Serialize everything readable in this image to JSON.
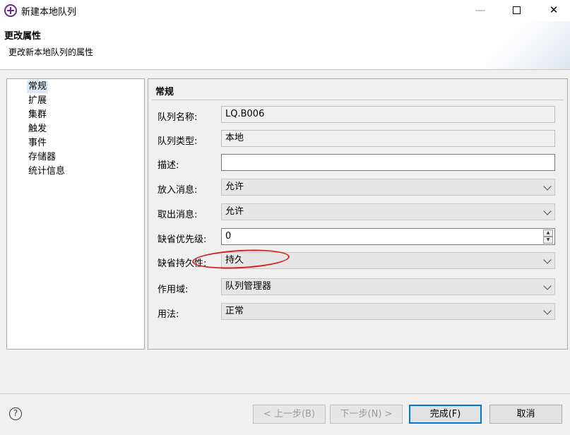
{
  "window": {
    "title": "新建本地队列",
    "minimize_icon": "—",
    "close_icon": "✕"
  },
  "banner": {
    "title": "更改属性",
    "subtitle": "更改新本地队列的属性"
  },
  "nav": {
    "items": [
      "常规",
      "扩展",
      "集群",
      "触发",
      "事件",
      "存储器",
      "统计信息"
    ],
    "selected": "常规"
  },
  "panel": {
    "title": "常规",
    "fields": {
      "queue_name": {
        "label": "队列名称:",
        "value": "LQ.B006"
      },
      "queue_type": {
        "label": "队列类型:",
        "value": "本地"
      },
      "description": {
        "label": "描述:",
        "value": ""
      },
      "put_messages": {
        "label": "放入消息:",
        "value": "允许"
      },
      "get_messages": {
        "label": "取出消息:",
        "value": "允许"
      },
      "default_priority": {
        "label": "缺省优先级:",
        "value": "0"
      },
      "default_persistence": {
        "label": "缺省持久性:",
        "value": "持久"
      },
      "scope": {
        "label": "作用域:",
        "value": "队列管理器"
      },
      "usage": {
        "label": "用法:",
        "value": "正常"
      }
    }
  },
  "footer": {
    "help_icon": "?",
    "back": "< 上一步(B)",
    "next": "下一步(N) >",
    "finish": "完成(F)",
    "cancel": "取消"
  },
  "colors": {
    "annotation": "#d62020",
    "default_button_border": "#0078d7",
    "selection": "#dce8f5"
  }
}
